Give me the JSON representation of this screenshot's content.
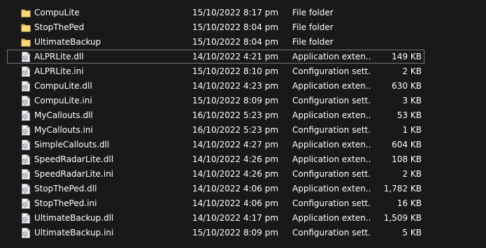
{
  "files": [
    {
      "name": "CompuLite",
      "date": "15/10/2022 8:17 pm",
      "type": "File folder",
      "size": "",
      "kind": "folder"
    },
    {
      "name": "StopThePed",
      "date": "15/10/2022 8:04 pm",
      "type": "File folder",
      "size": "",
      "kind": "folder"
    },
    {
      "name": "UltimateBackup",
      "date": "15/10/2022 8:04 pm",
      "type": "File folder",
      "size": "",
      "kind": "folder"
    },
    {
      "name": "ALPRLite.dll",
      "date": "14/10/2022 4:21 pm",
      "type": "Application exten...",
      "size": "149 KB",
      "kind": "dll",
      "selected": true
    },
    {
      "name": "ALPRLite.ini",
      "date": "15/10/2022 8:10 pm",
      "type": "Configuration sett...",
      "size": "2 KB",
      "kind": "ini"
    },
    {
      "name": "CompuLite.dll",
      "date": "14/10/2022 4:23 pm",
      "type": "Application exten...",
      "size": "630 KB",
      "kind": "dll"
    },
    {
      "name": "CompuLite.ini",
      "date": "15/10/2022 8:09 pm",
      "type": "Configuration sett...",
      "size": "3 KB",
      "kind": "ini"
    },
    {
      "name": "MyCallouts.dll",
      "date": "16/10/2022 5:23 pm",
      "type": "Application exten...",
      "size": "53 KB",
      "kind": "dll"
    },
    {
      "name": "MyCallouts.ini",
      "date": "16/10/2022 5:23 pm",
      "type": "Configuration sett...",
      "size": "1 KB",
      "kind": "ini"
    },
    {
      "name": "SimpleCallouts.dll",
      "date": "14/10/2022 4:27 pm",
      "type": "Application exten...",
      "size": "604 KB",
      "kind": "dll"
    },
    {
      "name": "SpeedRadarLite.dll",
      "date": "14/10/2022 4:26 pm",
      "type": "Application exten...",
      "size": "108 KB",
      "kind": "dll"
    },
    {
      "name": "SpeedRadarLite.ini",
      "date": "14/10/2022 4:26 pm",
      "type": "Configuration sett...",
      "size": "2 KB",
      "kind": "ini"
    },
    {
      "name": "StopThePed.dll",
      "date": "14/10/2022 4:06 pm",
      "type": "Application exten...",
      "size": "1,782 KB",
      "kind": "dll"
    },
    {
      "name": "StopThePed.ini",
      "date": "14/10/2022 4:06 pm",
      "type": "Configuration sett...",
      "size": "16 KB",
      "kind": "ini"
    },
    {
      "name": "UltimateBackup.dll",
      "date": "14/10/2022 4:17 pm",
      "type": "Application exten...",
      "size": "1,509 KB",
      "kind": "dll"
    },
    {
      "name": "UltimateBackup.ini",
      "date": "15/10/2022 8:09 pm",
      "type": "Configuration sett...",
      "size": "5 KB",
      "kind": "ini"
    }
  ],
  "icons": {
    "folder": "folder-icon",
    "dll": "gear-file-icon",
    "ini": "settings-file-icon"
  },
  "colors": {
    "background": "#191919",
    "text": "#ffffff",
    "folder": "#f8d775",
    "selection_border": "#777777"
  }
}
